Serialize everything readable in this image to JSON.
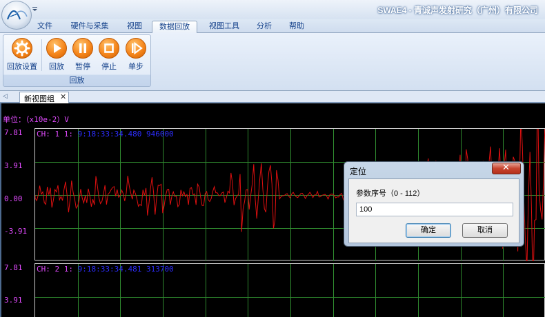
{
  "app": {
    "title": "SWAE4 - 青诚声发射研究（广州）有限公司"
  },
  "ribbon": {
    "tabs": [
      {
        "label": "文件",
        "active": false
      },
      {
        "label": "硬件与采集",
        "active": false
      },
      {
        "label": "视图",
        "active": false
      },
      {
        "label": "数据回放",
        "active": true
      },
      {
        "label": "视图工具",
        "active": false
      },
      {
        "label": "分析",
        "active": false
      },
      {
        "label": "帮助",
        "active": false
      }
    ],
    "group_label": "回放",
    "buttons": [
      {
        "label": "回放设置",
        "icon": "gear-icon"
      },
      {
        "label": "回放",
        "icon": "play-icon"
      },
      {
        "label": "暂停",
        "icon": "pause-icon"
      },
      {
        "label": "停止",
        "icon": "stop-icon"
      },
      {
        "label": "单步",
        "icon": "step-icon"
      }
    ],
    "accent_color": "#f5861c"
  },
  "document": {
    "tab_label": "新视图组",
    "close_glyph": "✕",
    "left_arrow": "◁"
  },
  "plot": {
    "unit_label": "单位：（x10e-2）V",
    "y_ticks_panel1": [
      "7.81",
      "3.91",
      "0.00",
      "-3.91"
    ],
    "y_ticks_panel2": [
      "7.81",
      "3.91"
    ],
    "channels": [
      {
        "prefix": "CH: 1 1:",
        "timestamp": "9:18:33:34.480 946000"
      },
      {
        "prefix": "CH: 2 1:",
        "timestamp": "9:18:33:34.481 313700"
      }
    ],
    "trace_color": "#e01010",
    "grid_color": "#2f8a2f"
  },
  "dialog": {
    "title": "定位",
    "close_glyph": "✕",
    "prompt": "参数序号（0 - 112）",
    "input_value": "100",
    "ok_label": "确定",
    "cancel_label": "取消"
  }
}
